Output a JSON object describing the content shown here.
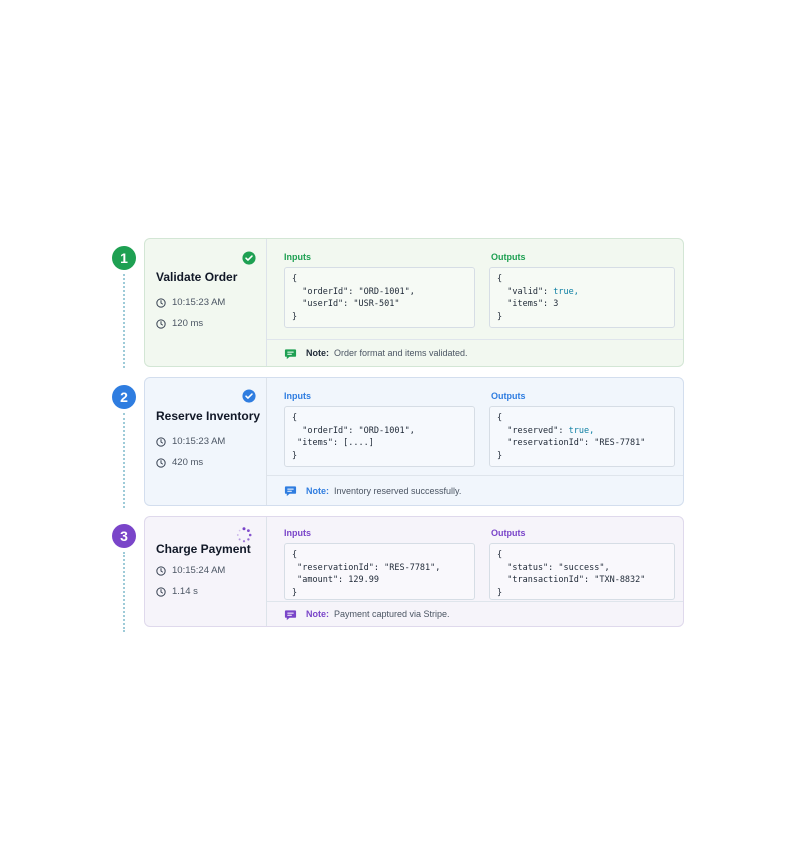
{
  "labels": {
    "inputs": "Inputs",
    "outputs": "Outputs",
    "note": "Note:"
  },
  "steps": [
    {
      "number": "1",
      "title": "Validate Order",
      "time": "10:15:23 AM",
      "duration": "120 ms",
      "status": "completed",
      "status_icon": "check-circle-icon",
      "accent": "#1ea052",
      "card_bg": "#f2f8f0",
      "inputs": {
        "open": "{",
        "lines": [
          "  \"orderId\": \"ORD-1001\",",
          "  \"userId\": \"USR-501\""
        ],
        "close": "}"
      },
      "outputs": {
        "open": "{",
        "lines": [
          "  \"valid\": ",
          "  \"items\": 3"
        ],
        "valid_value": "true,",
        "close": "}"
      },
      "note": "Order format and items validated."
    },
    {
      "number": "2",
      "title": "Reserve Inventory",
      "time": "10:15:23 AM",
      "duration": "420 ms",
      "status": "completed",
      "status_icon": "check-circle-icon",
      "accent": "#2f7de0",
      "card_bg": "#f1f6fc",
      "inputs": {
        "open": "{",
        "lines": [
          "  \"orderId\": \"ORD-1001\",",
          " \"items\": [....]"
        ],
        "close": "}"
      },
      "outputs": {
        "open": "{",
        "lines": [
          "  \"reserved\": ",
          "  \"reservationId\": \"RES-7781\""
        ],
        "reserved_value": "true,",
        "close": "}"
      },
      "note": "Inventory reserved successfully."
    },
    {
      "number": "3",
      "title": "Charge Payment",
      "time": "10:15:24 AM",
      "duration": "1.14 s",
      "status": "in-progress",
      "status_icon": "spinner-icon",
      "accent": "#7a45c9",
      "card_bg": "#f6f4fa",
      "inputs": {
        "open": "{",
        "lines": [
          " \"reservationId\": \"RES-7781\",",
          " \"amount\": 129.99"
        ],
        "close": "}"
      },
      "outputs": {
        "open": "{",
        "lines": [
          "  \"status\": \"success\",",
          "  \"transactionId\": \"TXN-8832\""
        ],
        "close": "}"
      },
      "note": "Payment captured via Stripe."
    }
  ]
}
